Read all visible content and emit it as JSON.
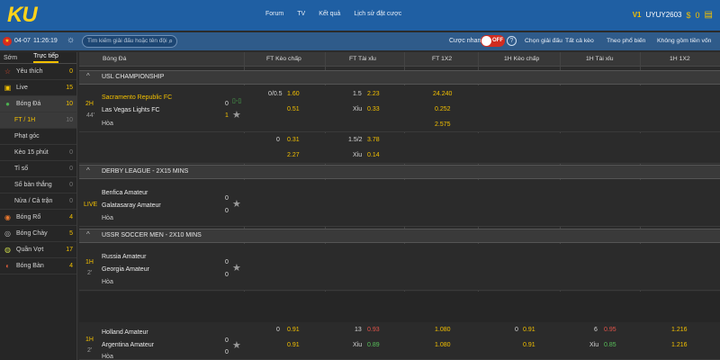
{
  "header": {
    "logo": "KU",
    "nav": [
      "Forum",
      "TV",
      "Kết quả",
      "Lịch sử đặt cược"
    ],
    "vip": "V1",
    "username": "UYUY2603",
    "currency_symbol": "$",
    "balance": "0"
  },
  "subheader": {
    "date": "04-07",
    "time": "11:26:19",
    "search_placeholder": "Tìm kiếm giải đấu hoặc tên đội",
    "quick_bet_label": "Cược nhanh",
    "toggle_state": "OFF",
    "options": [
      "Chọn giải đấu",
      "Tất cả kèo",
      "Theo phổ biến",
      "Không gồm tiền vốn"
    ]
  },
  "sidebar": {
    "tabs": [
      "Sớm",
      "Trực tiếp"
    ],
    "active_tab": "Trực tiếp",
    "items": [
      {
        "icon": "star-icon",
        "label": "Yêu thích",
        "count": "0"
      },
      {
        "icon": "tv-icon",
        "label": "Live",
        "count": "15"
      },
      {
        "icon": "soccer-icon",
        "label": "Bóng Đá",
        "count": "10",
        "active": true
      },
      {
        "label": "FT / 1H",
        "count": "10",
        "sub": true,
        "active": true
      },
      {
        "label": "Phạt góc",
        "count": "",
        "sub": true
      },
      {
        "label": "Kèo 15 phút",
        "count": "0",
        "sub": true
      },
      {
        "label": "Tỉ số",
        "count": "0",
        "sub": true
      },
      {
        "label": "Số bàn thắng",
        "count": "0",
        "sub": true
      },
      {
        "label": "Nửa / Cả trận",
        "count": "0",
        "sub": true
      },
      {
        "icon": "basketball-icon",
        "label": "Bóng Rổ",
        "count": "4"
      },
      {
        "icon": "hockey-icon",
        "label": "Bóng Chày",
        "count": "5"
      },
      {
        "icon": "tennis-icon",
        "label": "Quần Vợt",
        "count": "17"
      },
      {
        "icon": "pingpong-icon",
        "label": "Bóng Bàn",
        "count": "4"
      }
    ]
  },
  "table": {
    "columns": [
      "Bóng Đá",
      "FT Kèo chấp",
      "FT Tài xỉu",
      "FT 1X2",
      "1H Kèo chấp",
      "1H Tài xỉu",
      "1H 1X2"
    ],
    "leagues": [
      {
        "name": "USL CHAMPIONSHIP",
        "match": {
          "period": "2H",
          "minute": "44'",
          "home": "Sacramento Republic FC",
          "away": "Las Vegas Lights FC",
          "draw_label": "Hòa",
          "home_score": "0",
          "away_score": "1",
          "odds_row1": {
            "hdp": "0/0.5",
            "hdp_home": "1.60",
            "ou_line": "1.5",
            "ou_over": "2.23",
            "x12_home": "24.240"
          },
          "odds_row2": {
            "hdp_away": "0.51",
            "ou_label": "Xỉu",
            "ou_under": "0.33",
            "x12_away": "0.252"
          },
          "odds_row3": {
            "x12_draw": "2.575"
          },
          "alt_row1": {
            "hdp": "0",
            "hdp_home": "0.31",
            "ou_line": "1.5/2",
            "ou_over": "3.78"
          },
          "alt_row2": {
            "hdp_away": "2.27",
            "ou_label": "Xỉu",
            "ou_under": "0.14"
          }
        }
      },
      {
        "name": "DERBY LEAGUE - 2X15 MINS",
        "match": {
          "period": "LIVE",
          "home": "Benfica Amateur",
          "away": "Galatasaray Amateur",
          "draw_label": "Hòa",
          "home_score": "0",
          "away_score": "0"
        }
      },
      {
        "name": "USSR SOCCER MEN - 2X10 MINS",
        "match": {
          "period": "1H",
          "minute": "2'",
          "home": "Russia Amateur",
          "away": "Georgia Amateur",
          "draw_label": "Hòa",
          "home_score": "0",
          "away_score": "0"
        }
      }
    ],
    "extra_match": {
      "period": "1H",
      "minute": "2'",
      "home": "Holland Amateur",
      "away": "Argentina Amateur",
      "draw_label": "Hòa",
      "home_score": "0",
      "away_score": "0",
      "row1": {
        "hdp": "0",
        "hdp_home": "0.91",
        "ou_line": "13",
        "ou_over": "0.93",
        "x12_home": "1.080",
        "h1_hdp": "0",
        "h1_hdp_home": "0.91",
        "h1_ou_line": "6",
        "h1_ou_over": "0.95",
        "h1_x12_home": "1.216"
      },
      "row2": {
        "hdp_away": "0.91",
        "ou_label": "Xỉu",
        "ou_under": "0.89",
        "x12_away": "1.080",
        "h1_hdp_away": "0.91",
        "h1_ou_label": "Xỉu",
        "h1_ou_under": "0.85",
        "h1_x12_away": "1.216"
      }
    }
  }
}
